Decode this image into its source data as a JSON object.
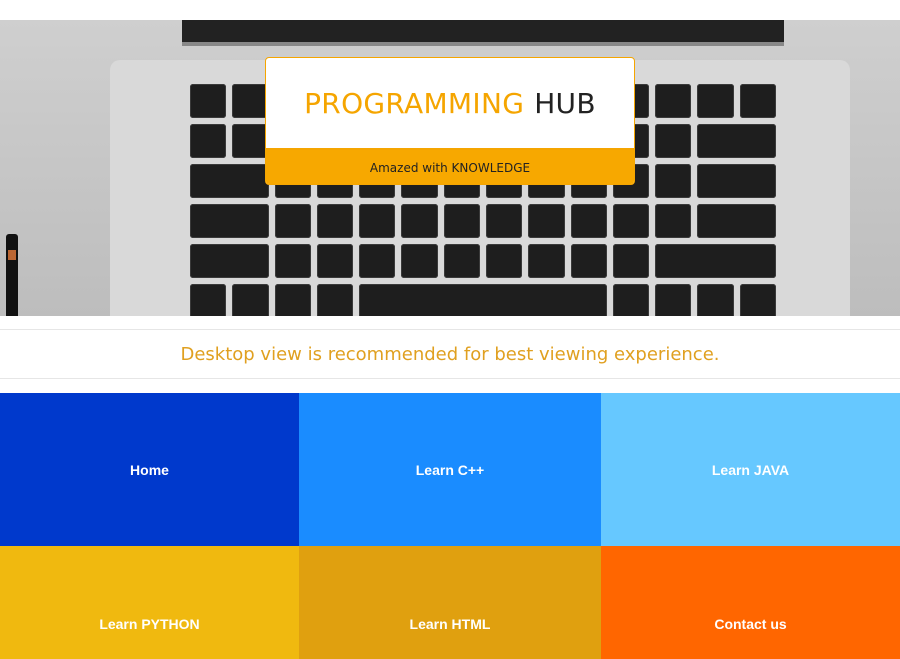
{
  "hero": {
    "title_part1": "PROGRAMMING",
    "title_part2": "HUB",
    "tagline": "Amazed with KNOWLEDGE"
  },
  "notice": {
    "text": "Desktop view is recommended for best viewing experience."
  },
  "tiles": [
    {
      "label": "Home",
      "color": "#0039cc"
    },
    {
      "label": "Learn C++",
      "color": "#1a8cff"
    },
    {
      "label": "Learn JAVA",
      "color": "#66c8ff"
    },
    {
      "label": "Learn PYTHON",
      "color": "#f0b90f"
    },
    {
      "label": "Learn HTML",
      "color": "#e0a00f"
    },
    {
      "label": "Contact us",
      "color": "#ff6600"
    }
  ],
  "colors": {
    "brand_orange": "#f5a500",
    "notice_text": "#e0a020"
  }
}
